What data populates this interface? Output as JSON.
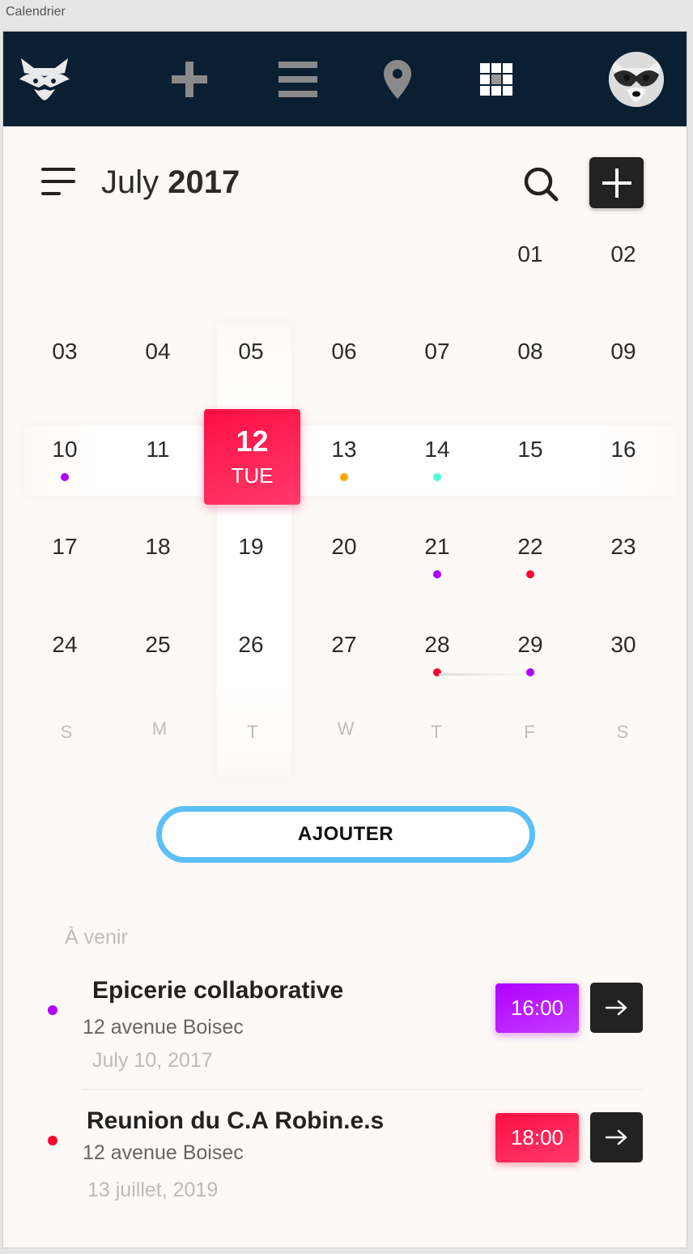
{
  "window": {
    "title": "Calendrier"
  },
  "topbar": {
    "icons": [
      "raccoon-logo-icon",
      "plus-icon",
      "menu-icon",
      "location-pin-icon",
      "grid-icon",
      "avatar"
    ],
    "background": "#0b1f33",
    "icon_color": "#8a8a8a"
  },
  "header": {
    "month": "July",
    "year": "2017"
  },
  "calendar": {
    "days": [
      [
        "",
        "",
        "",
        "",
        "",
        "01",
        "02"
      ],
      [
        "03",
        "04",
        "05",
        "06",
        "07",
        "08",
        "09"
      ],
      [
        "10",
        "11",
        "12",
        "13",
        "14",
        "15",
        "16"
      ],
      [
        "17",
        "18",
        "19",
        "20",
        "21",
        "22",
        "23"
      ],
      [
        "24",
        "25",
        "26",
        "27",
        "28",
        "29",
        "30"
      ]
    ],
    "weekdays": [
      "S",
      "M",
      "T",
      "W",
      "T",
      "F",
      "S"
    ],
    "selected": {
      "day": "12",
      "weekday": "TUE"
    },
    "event_dots": [
      {
        "day": "10",
        "color": "#b000ff"
      },
      {
        "day": "13",
        "color": "#ffa500"
      },
      {
        "day": "14",
        "color": "#4dffd2"
      },
      {
        "day": "21",
        "color": "#b000ff"
      },
      {
        "day": "22",
        "color": "#ff0033"
      },
      {
        "day": "28",
        "color": "#ff0033"
      },
      {
        "day": "29",
        "color": "#b000ff"
      }
    ]
  },
  "add_button": {
    "label": "AJOUTER",
    "border_color": "#5bc0f7"
  },
  "upcoming": {
    "title": "À venir",
    "events": [
      {
        "title": "Epicerie collaborative",
        "address": "12 avenue Boisec",
        "date": "July 10, 2017",
        "time": "16:00",
        "color": "#b000ff"
      },
      {
        "title": "Reunion du C.A Robin.e.s",
        "address": "12 avenue Boisec",
        "date": "13 juillet, 2019",
        "time": "18:00",
        "color": "#ff0033"
      }
    ]
  }
}
